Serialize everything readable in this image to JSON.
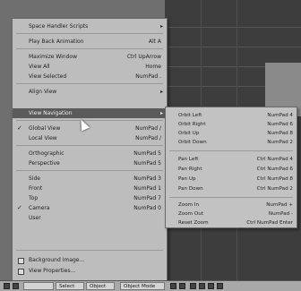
{
  "main_menu": {
    "items": [
      {
        "label": "Space Handler Scripts",
        "shortcut": "",
        "submenu": true
      },
      {
        "label": "Play Back Animation",
        "shortcut": "Alt A"
      },
      {
        "label": "Maximize Window",
        "shortcut": "Ctrl UpArrow"
      },
      {
        "label": "View All",
        "shortcut": "Home"
      },
      {
        "label": "View Selected",
        "shortcut": "NumPad ."
      },
      {
        "label": "Align View",
        "shortcut": "",
        "submenu": true
      },
      {
        "label": "View Navigation",
        "shortcut": "",
        "submenu": true,
        "highlighted": true
      },
      {
        "label": "Global View",
        "shortcut": "NumPad /",
        "checked": true
      },
      {
        "label": "Local View",
        "shortcut": "NumPad /"
      },
      {
        "label": "Orthographic",
        "shortcut": "NumPad 5"
      },
      {
        "label": "Perspective",
        "shortcut": "NumPad 5"
      },
      {
        "label": "Side",
        "shortcut": "NumPad 3"
      },
      {
        "label": "Front",
        "shortcut": "NumPad 1"
      },
      {
        "label": "Top",
        "shortcut": "NumPad 7"
      },
      {
        "label": "Camera",
        "shortcut": "NumPad 0",
        "checked": true
      },
      {
        "label": "User",
        "shortcut": ""
      },
      {
        "label": "Background Image...",
        "shortcut": ""
      },
      {
        "label": "View Properties...",
        "shortcut": ""
      }
    ]
  },
  "sub_menu": {
    "items": [
      {
        "label": "Orbit Left",
        "shortcut": "NumPad 4"
      },
      {
        "label": "Orbit Right",
        "shortcut": "NumPad 6"
      },
      {
        "label": "Orbit Up",
        "shortcut": "NumPad 8"
      },
      {
        "label": "Orbit Down",
        "shortcut": "NumPad 2"
      },
      {
        "label": "Pan Left",
        "shortcut": "Ctrl NumPad 4"
      },
      {
        "label": "Pan Right",
        "shortcut": "Ctrl NumPad 6"
      },
      {
        "label": "Pan Up",
        "shortcut": "Ctrl NumPad 8"
      },
      {
        "label": "Pan Down",
        "shortcut": "Ctrl NumPad 2"
      },
      {
        "label": "Zoom In",
        "shortcut": "NumPad +"
      },
      {
        "label": "Zoom Out",
        "shortcut": "NumPad -"
      },
      {
        "label": "Reset Zoom",
        "shortcut": "Ctrl NumPad Enter"
      }
    ]
  },
  "header_bar": {
    "select_label": "Select",
    "object_label": "Object",
    "mode_label": "Object Mode"
  },
  "icons": {
    "check": "✓",
    "submenu_arrow": "▸"
  },
  "colors": {
    "menu_bg": "#bdbdbd",
    "highlight": "#5a5a5a",
    "viewport_bg": "#3d3d3d"
  }
}
